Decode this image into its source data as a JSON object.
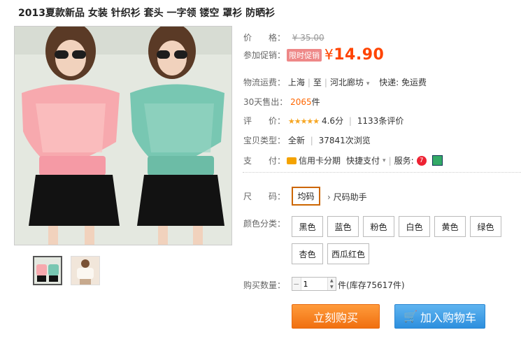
{
  "title": "2013夏款新品 女装 针织衫 套头 一字领 镂空 罩衫 防晒衫",
  "images": {
    "main": "pink-and-mint-knit-tops-photo",
    "thumbnails": [
      "knit-tops-thumbnail",
      "white-top-thumbnail"
    ]
  },
  "price": {
    "label": "价　　格：",
    "original": "¥ 35.00"
  },
  "promo": {
    "label": "参加促销：",
    "tag": "限时促销",
    "currency": "¥",
    "value": "14.90"
  },
  "shipping": {
    "label": "物流运费：",
    "from": "上海",
    "sep": "至",
    "to": "河北廊坊",
    "method": "快递: 免运费"
  },
  "sales": {
    "label": "30天售出：",
    "count": "2065",
    "unit": "件"
  },
  "rating": {
    "label": "评　　价：",
    "stars": "★★★★★",
    "score": "4.6分",
    "reviews": "1133条评价"
  },
  "product_type": {
    "label": "宝贝类型：",
    "condition": "全新",
    "views": "37841次浏览"
  },
  "payment": {
    "label": "支　　付：",
    "credit": "信用卡分期",
    "quick": "快捷支付",
    "service_label": "服务:"
  },
  "size": {
    "label": "尺　　码：",
    "selected": "均码",
    "helper": "尺码助手"
  },
  "colors": {
    "label": "颜色分类：",
    "options": [
      "黑色",
      "蓝色",
      "粉色",
      "白色",
      "黄色",
      "绿色",
      "杏色",
      "西瓜红色"
    ]
  },
  "quantity": {
    "label": "购买数量：",
    "value": "1",
    "unit": "件",
    "stock": "(库存75617件)"
  },
  "buttons": {
    "buy": "立刻购买",
    "cart": "加入购物车"
  },
  "accent": {
    "price": "#ff4400",
    "buy": "#f47a1c",
    "cart": "#3a97e0"
  }
}
